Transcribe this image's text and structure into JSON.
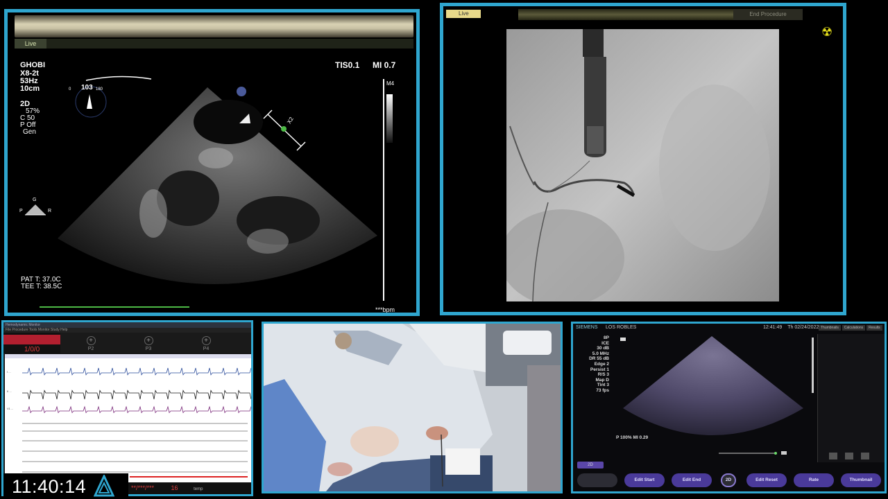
{
  "tee": {
    "live_label": "Live",
    "patient": "GHOBI",
    "probe": "X8-2t",
    "frame_rate": "53Hz",
    "depth": "10cm",
    "mode": "2D",
    "gain": "57%",
    "compress": "C 50",
    "power": "P Off",
    "gen": "Gen",
    "tis": "TIS0.1",
    "mi": "MI 0.7",
    "m_label": "M4",
    "angle": "103",
    "angle_min": "0",
    "angle_max": "180",
    "x2": "X2",
    "orient_top": "G",
    "orient_left": "P",
    "orient_right": "R",
    "pat_temp": "PAT T: 37.0C",
    "tee_temp": "TEE T: 38.5C",
    "hr": "***bpm"
  },
  "fluoro": {
    "live_label": "Live",
    "end_procedure": "End Procedure",
    "radiation_icon": "radiation-icon"
  },
  "ecg": {
    "title_bar": "Hemodynamic Monitor",
    "menu_bar": "File  Procedure  Tools  Monitor  Study  Help",
    "nibp_value": "1/0/0",
    "p_labels": [
      "P2",
      "P3",
      "P4"
    ],
    "lead_labels": [
      "I  ...",
      "II  ...",
      "V1  ..."
    ],
    "bottom_text": "**/***/***",
    "bottom_num": "16",
    "bottom_right": "temp"
  },
  "clock": {
    "time": "11:40:14"
  },
  "ice": {
    "brand": "SIEMENS",
    "hospital": "LOS ROBLES",
    "time": "12:41:49",
    "date": "Th  02/24/2022",
    "tabs": [
      "Thumbnails",
      "Calculations",
      "Results"
    ],
    "params": [
      "8P",
      "ICE",
      "30 dB",
      "5.0 MHz",
      "DR 55 dB",
      "Edge 2",
      "Persist 1",
      "R/S 3",
      "Map D",
      "Tint 3",
      "73 fps"
    ],
    "power_mi": "P 100%   MI 0.29",
    "mode_tab": "2D",
    "buttons": [
      "",
      "Edit Start",
      "Edit End",
      "2D",
      "Edit Reset",
      "Rate",
      "Thumbnail"
    ]
  },
  "colors": {
    "panel_border": "#2fa6cf",
    "ice_button": "#4a3a9a",
    "ecg_alarm": "#b21f2f"
  }
}
